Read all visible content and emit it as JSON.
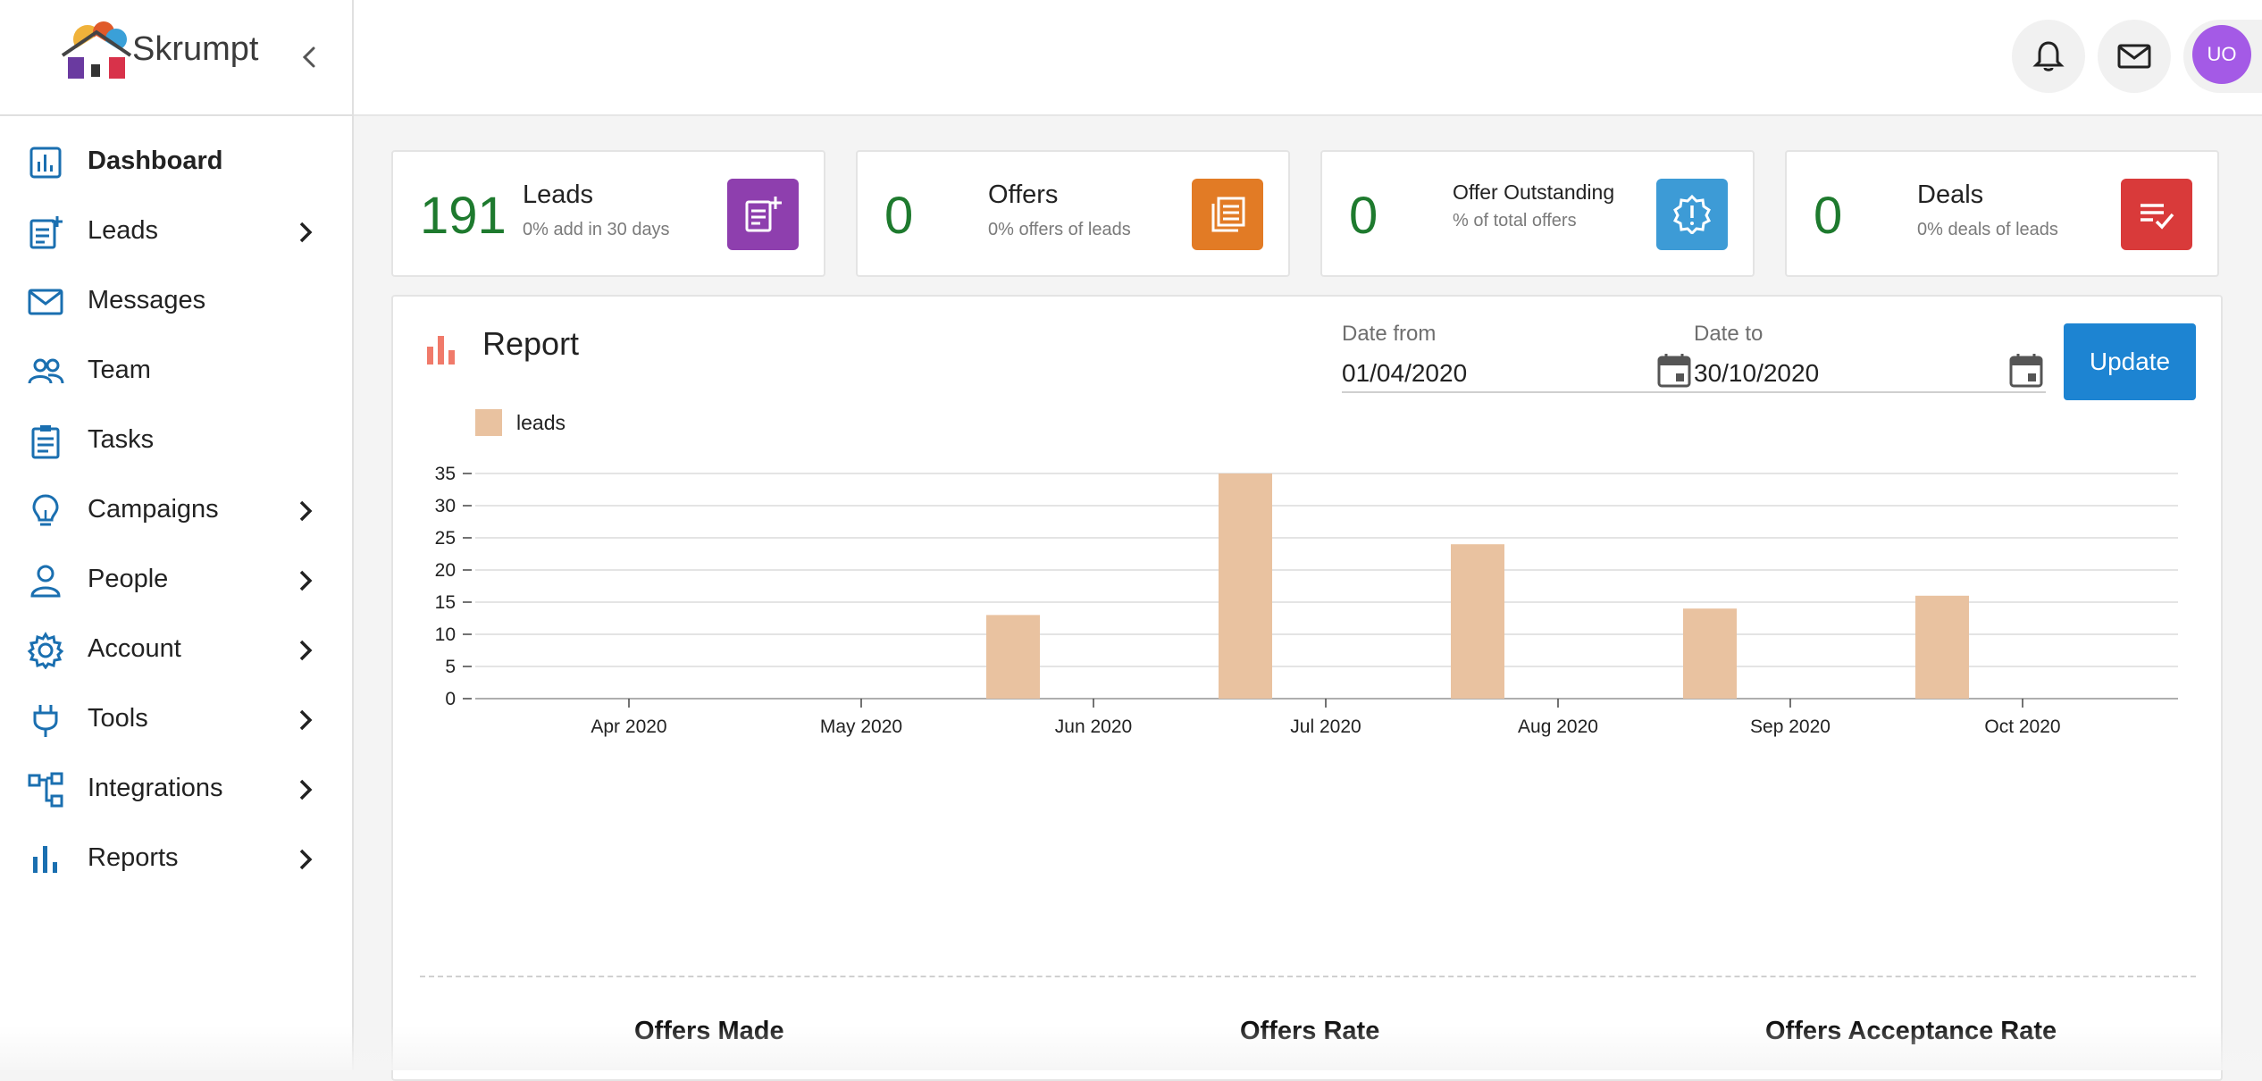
{
  "app": {
    "name": "Skrumpt"
  },
  "sidebar": {
    "items": [
      {
        "label": "Dashboard",
        "icon": "dashboard-icon",
        "has_children": false
      },
      {
        "label": "Leads",
        "icon": "leads-icon",
        "has_children": true
      },
      {
        "label": "Messages",
        "icon": "mail-icon",
        "has_children": false
      },
      {
        "label": "Team",
        "icon": "team-icon",
        "has_children": false
      },
      {
        "label": "Tasks",
        "icon": "clipboard-icon",
        "has_children": false
      },
      {
        "label": "Campaigns",
        "icon": "lightbulb-icon",
        "has_children": true
      },
      {
        "label": "People",
        "icon": "person-icon",
        "has_children": true
      },
      {
        "label": "Account",
        "icon": "gear-icon",
        "has_children": true
      },
      {
        "label": "Tools",
        "icon": "plug-icon",
        "has_children": true
      },
      {
        "label": "Integrations",
        "icon": "integrations-icon",
        "has_children": true
      },
      {
        "label": "Reports",
        "icon": "bar-chart-icon",
        "has_children": true
      }
    ]
  },
  "header": {
    "avatar_initials": "UO"
  },
  "cards": [
    {
      "value": "191",
      "title": "Leads",
      "subtitle": "0% add in 30 days",
      "color": "#8e3fae",
      "icon": "add-note-icon"
    },
    {
      "value": "0",
      "title": "Offers",
      "subtitle": "0% offers of leads",
      "color": "#e27b25",
      "icon": "documents-icon"
    },
    {
      "value": "0",
      "title": "Offer Outstanding",
      "subtitle": "% of total offers",
      "color": "#3d9bd6",
      "icon": "alert-badge-icon"
    },
    {
      "value": "0",
      "title": "Deals",
      "subtitle": "0% deals of leads",
      "color": "#d93a3a",
      "icon": "list-check-icon"
    }
  ],
  "report": {
    "title": "Report",
    "date_from_label": "Date from",
    "date_from": "01/04/2020",
    "date_to_label": "Date to",
    "date_to": "30/10/2020",
    "update_label": "Update",
    "metrics": [
      "Offers Made",
      "Offers Rate",
      "Offers Acceptance Rate"
    ]
  },
  "chart_data": {
    "type": "bar",
    "categories": [
      "Apr 2020",
      "May 2020",
      "Jun 2020",
      "Jul 2020",
      "Aug 2020",
      "Sep 2020",
      "Oct 2020"
    ],
    "series": [
      {
        "name": "leads",
        "values": [
          0,
          0,
          13,
          35,
          24,
          14,
          16
        ],
        "color": "#e9c2a0"
      }
    ],
    "yticks": [
      0,
      5,
      10,
      15,
      20,
      25,
      30,
      35
    ],
    "ylim": [
      0,
      35
    ],
    "grid": true,
    "legend": "top-left"
  }
}
